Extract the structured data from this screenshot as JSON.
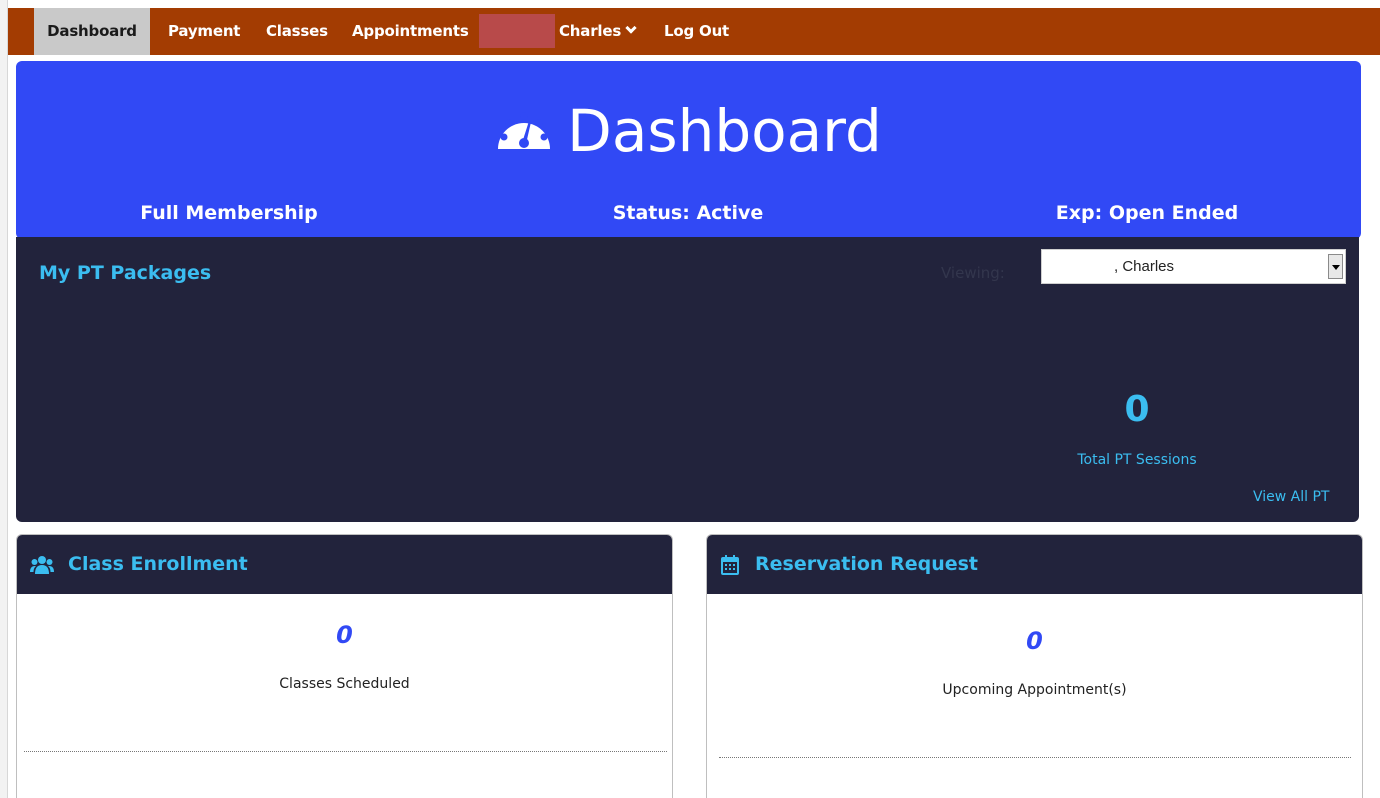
{
  "nav": {
    "items": [
      {
        "label": "Dashboard",
        "active": true
      },
      {
        "label": "Payment"
      },
      {
        "label": "Classes"
      },
      {
        "label": "Appointments"
      }
    ],
    "user_label": "Charles",
    "logout_label": "Log Out"
  },
  "hero": {
    "title": "Dashboard",
    "membership": "Full Membership",
    "status": "Status: Active",
    "expiration": "Exp: Open Ended"
  },
  "pt_packages": {
    "title": "My PT Packages",
    "viewing_label": "Viewing:",
    "selected_client": ", Charles",
    "total_sessions": "0",
    "total_sessions_label": "Total PT Sessions",
    "view_all_label": "View All PT"
  },
  "class_enrollment": {
    "title": "Class Enrollment",
    "count": "0",
    "count_label": "Classes Scheduled"
  },
  "reservation_request": {
    "title": "Reservation Request",
    "count": "0",
    "count_label": "Upcoming Appointment(s)"
  },
  "colors": {
    "nav_bg": "#a33c02",
    "hero_bg": "#3149f5",
    "panel_bg": "#22233c",
    "accent": "#3bbdf0"
  },
  "icons": {
    "dashboard": "gauge-icon",
    "class_enrollment": "users-icon",
    "reservation_request": "calendar-icon",
    "user_menu": "chevron-down-icon"
  }
}
